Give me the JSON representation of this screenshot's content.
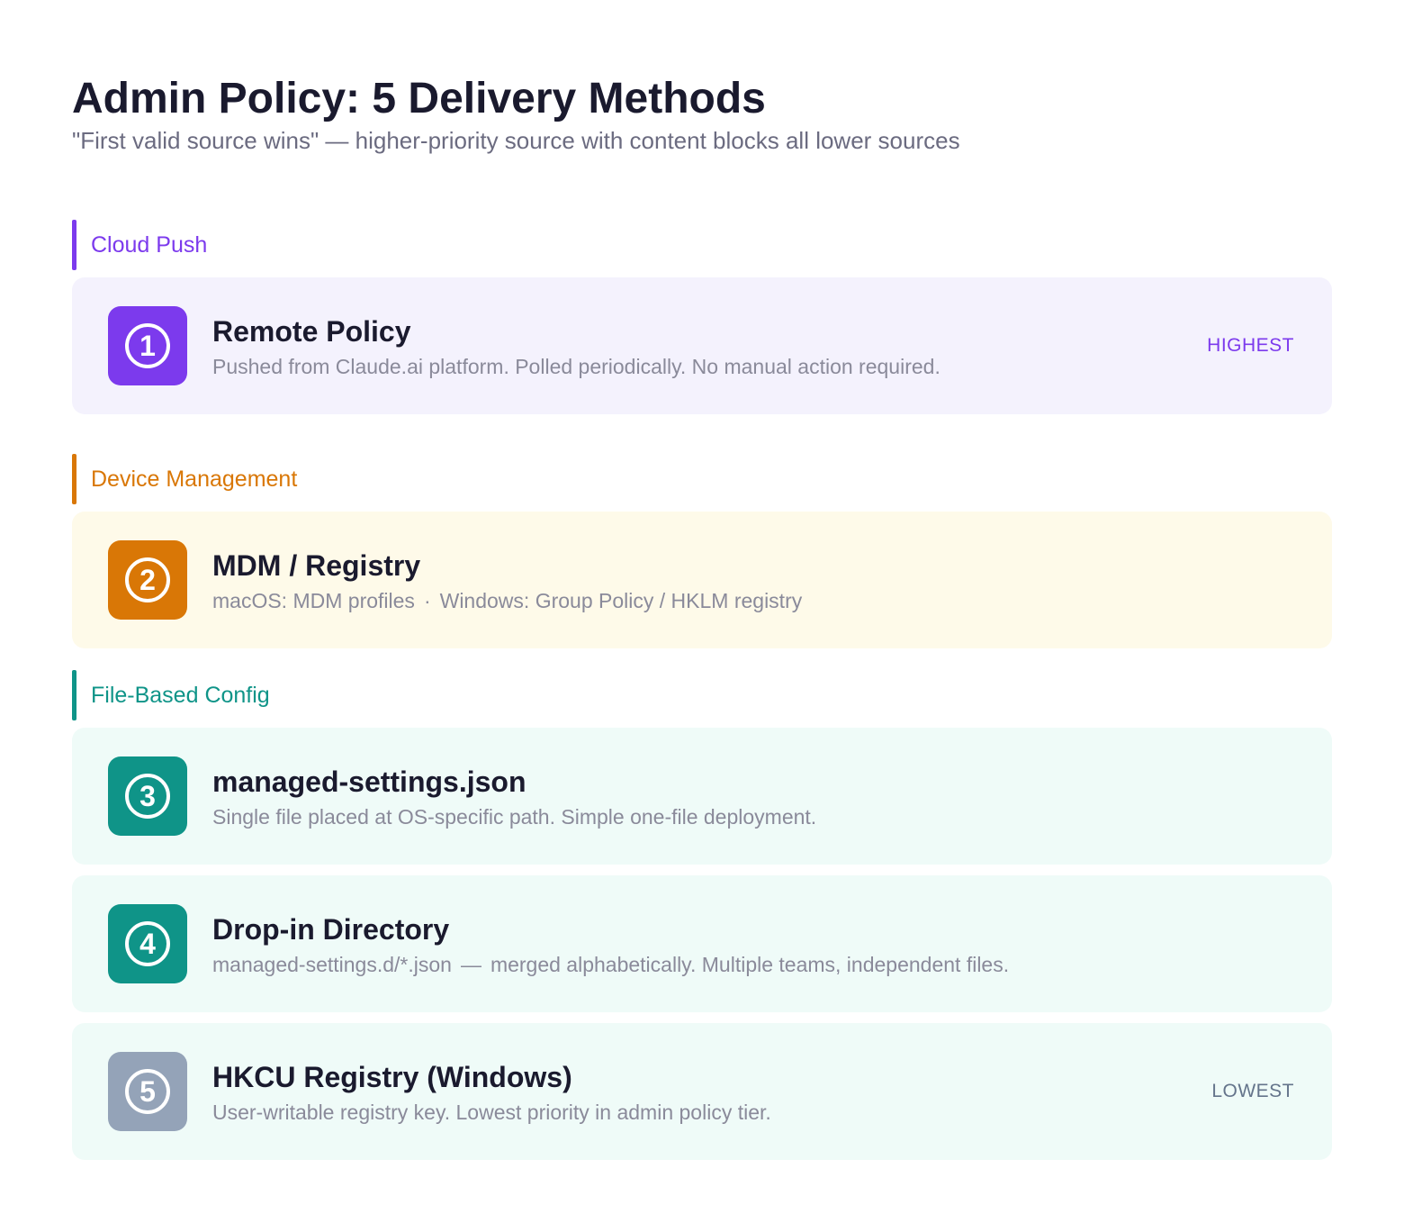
{
  "title": "Admin Policy: 5 Delivery Methods",
  "subtitle": "\"First valid source wins\" — higher-priority source with content blocks all lower sources",
  "colors": {
    "cloud_accent": "#7c3aed",
    "cloud_bg": "#f4f2fd",
    "device_accent": "#d97706",
    "device_bg": "#fefae9",
    "file_accent": "#0f9488",
    "file_bg": "#effbf8",
    "lowest_badge": "#94a3b8",
    "lowest_tag": "#64748b"
  },
  "sections": [
    {
      "label": "Cloud Push",
      "cards": [
        {
          "number": "1",
          "title": "Remote Policy",
          "description": "Pushed from Claude.ai platform. Polled periodically. No manual action required.",
          "tag": "HIGHEST"
        }
      ]
    },
    {
      "label": "Device Management",
      "cards": [
        {
          "number": "2",
          "title": "MDM / Registry",
          "description_parts": [
            "macOS: MDM profiles",
            "·",
            "Windows: Group Policy / HKLM registry"
          ]
        }
      ]
    },
    {
      "label": "File-Based Config",
      "cards": [
        {
          "number": "3",
          "title": "managed-settings.json",
          "description": "Single file placed at OS-specific path. Simple one-file deployment."
        },
        {
          "number": "4",
          "title": "Drop-in Directory",
          "description_parts": [
            "managed-settings.d/*.json",
            "—",
            "merged alphabetically. Multiple teams, independent files."
          ]
        },
        {
          "number": "5",
          "title": "HKCU Registry (Windows)",
          "description": "User-writable registry key. Lowest priority in admin policy tier.",
          "tag": "LOWEST"
        }
      ]
    }
  ]
}
